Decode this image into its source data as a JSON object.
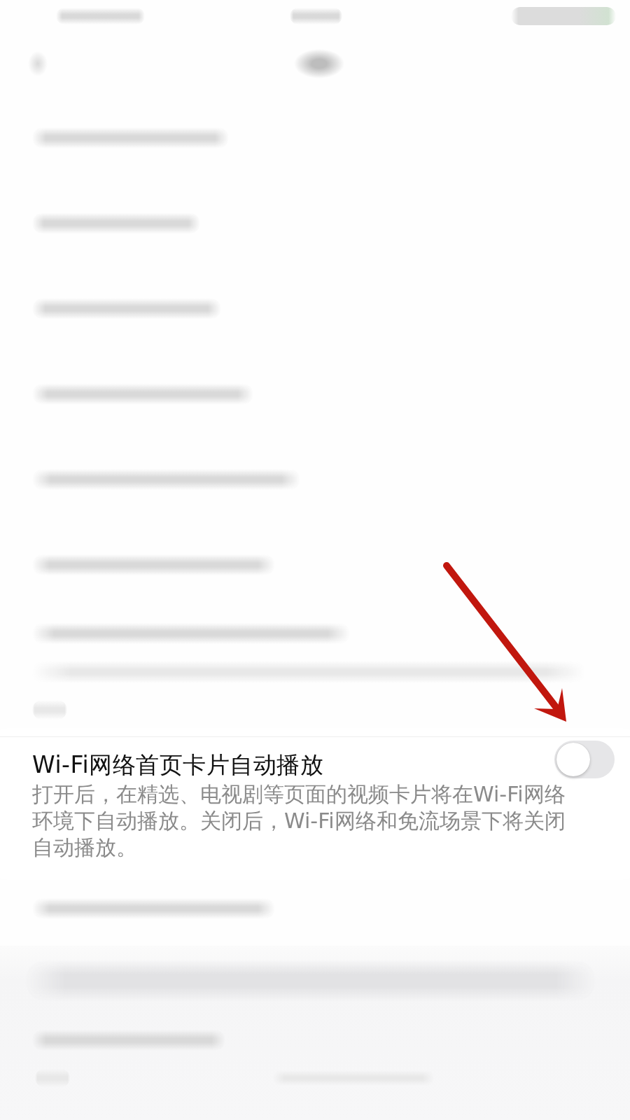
{
  "setting": {
    "title": "Wi-Fi网络首页卡片自动播放",
    "description": "打开后，在精选、电视剧等页面的视频卡片将在Wi-Fi网络环境下自动播放。关闭后，Wi-Fi网络和免流场景下将关闭自动播放。",
    "on": false
  }
}
